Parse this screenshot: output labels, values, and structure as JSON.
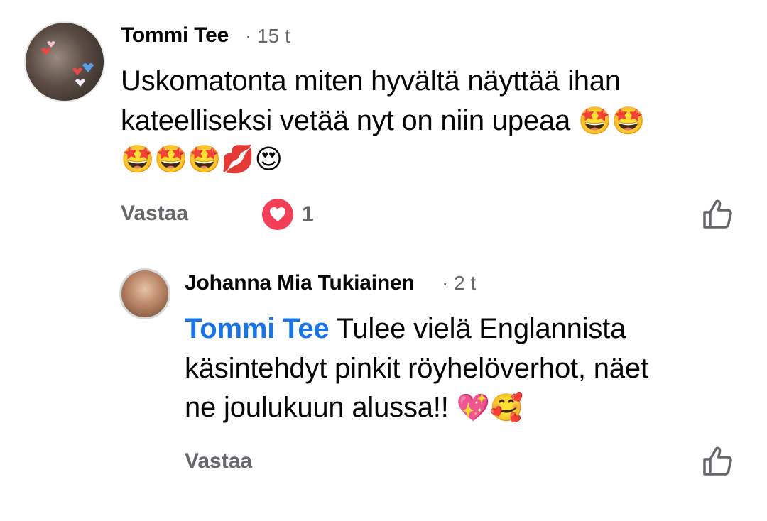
{
  "comment": {
    "author": "Tommi Tee",
    "time": "· 15 t",
    "text_line1": "Uskomatonta miten hyvältä näyttää ihan",
    "text_line2": "kateelliseksi vetää nyt on niin upeaa",
    "emoji_line2": "🤩🤩",
    "emoji_line3": "🤩🤩🤩💋😍",
    "reply_label": "Vastaa",
    "reaction_count": "1",
    "reaction_type": "love-reaction-icon"
  },
  "reply": {
    "author": "Johanna Mia Tukiainen",
    "time": "· 2 t",
    "mention": "Tommi Tee",
    "text_line1": "Tulee vielä Englannista",
    "text_line2": "käsintehdyt pinkit röyhelöverhot, näet",
    "text_line3": "ne joulukuun alussa!!",
    "emoji_line3": "💖🥰",
    "reply_label": "Vastaa"
  },
  "colors": {
    "mention": "#1b74e4",
    "meta_gray": "#65676b",
    "love_reaction": "#f33e58"
  }
}
